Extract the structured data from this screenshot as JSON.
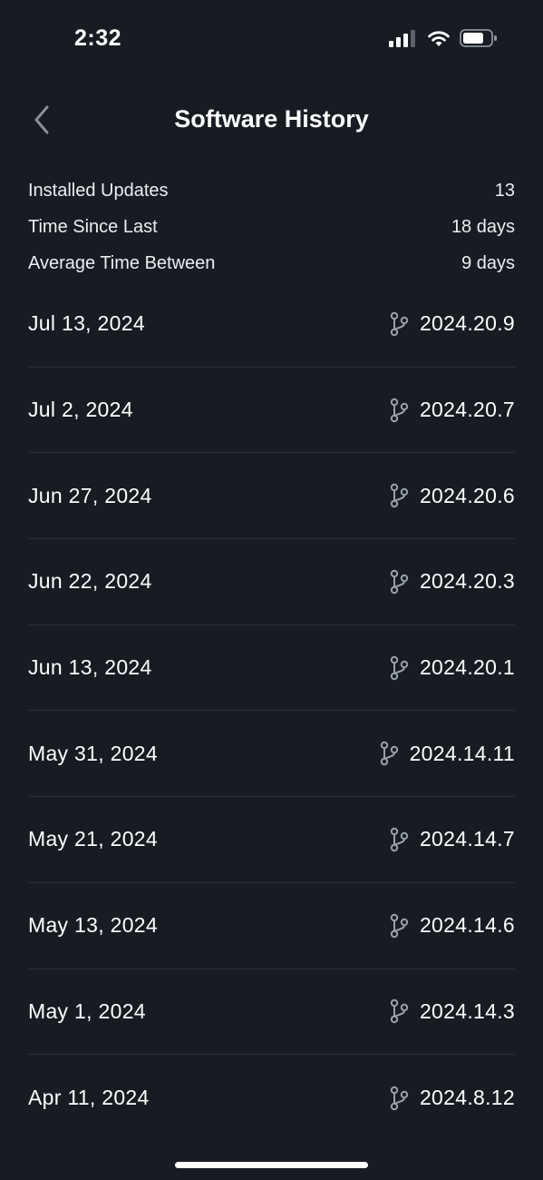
{
  "status_bar": {
    "time": "2:32"
  },
  "header": {
    "title": "Software History"
  },
  "stats": [
    {
      "label": "Installed Updates",
      "value": "13"
    },
    {
      "label": "Time Since Last",
      "value": "18 days"
    },
    {
      "label": "Average Time Between",
      "value": "9 days"
    }
  ],
  "history": [
    {
      "date": "Jul 13, 2024",
      "version": "2024.20.9"
    },
    {
      "date": "Jul 2, 2024",
      "version": "2024.20.7"
    },
    {
      "date": "Jun 27, 2024",
      "version": "2024.20.6"
    },
    {
      "date": "Jun 22, 2024",
      "version": "2024.20.3"
    },
    {
      "date": "Jun 13, 2024",
      "version": "2024.20.1"
    },
    {
      "date": "May 31, 2024",
      "version": "2024.14.11"
    },
    {
      "date": "May 21, 2024",
      "version": "2024.14.7"
    },
    {
      "date": "May 13, 2024",
      "version": "2024.14.6"
    },
    {
      "date": "May 1, 2024",
      "version": "2024.14.3"
    },
    {
      "date": "Apr 11, 2024",
      "version": "2024.8.12"
    }
  ],
  "icons": {
    "back": "chevron-left-icon",
    "version": "branch-icon",
    "signal": "cellular-signal-icon",
    "wifi": "wifi-icon",
    "battery": "battery-icon"
  },
  "colors": {
    "background": "#171b22",
    "text": "#ffffff",
    "divider": "#2a2f38",
    "icon_muted": "#9aa0a8"
  }
}
